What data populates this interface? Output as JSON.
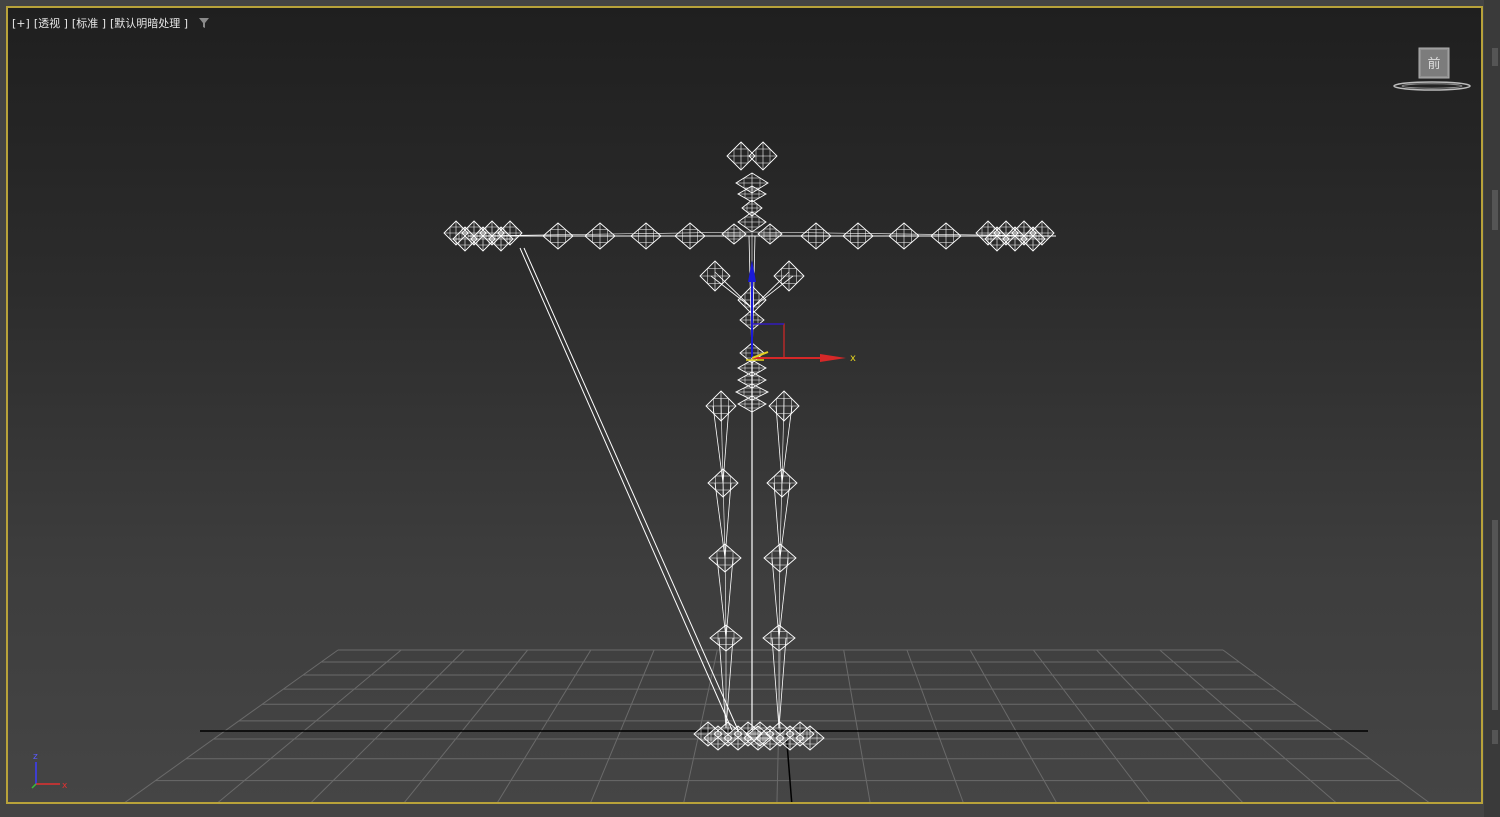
{
  "viewport": {
    "labels": {
      "plus": "[+]",
      "view": "[透视 ]",
      "mode": "[标准 ]",
      "shading": "[默认明暗处理 ]"
    },
    "viewcube_face": "前",
    "gizmo_axis_x": "x",
    "tripod": {
      "z": "z",
      "x": "x"
    }
  },
  "colors": {
    "viewport_border": "#b8a23a",
    "wire": "#ffffff",
    "axis_x": "#d62828",
    "axis_y": "#e0d020",
    "axis_z": "#1a1ad8",
    "grid": "#6a6a6a",
    "grid_axis": "#000000"
  },
  "icons": [
    "filter-icon",
    "viewcube-icon",
    "axis-tripod-icon",
    "transform-gizmo-icon"
  ]
}
